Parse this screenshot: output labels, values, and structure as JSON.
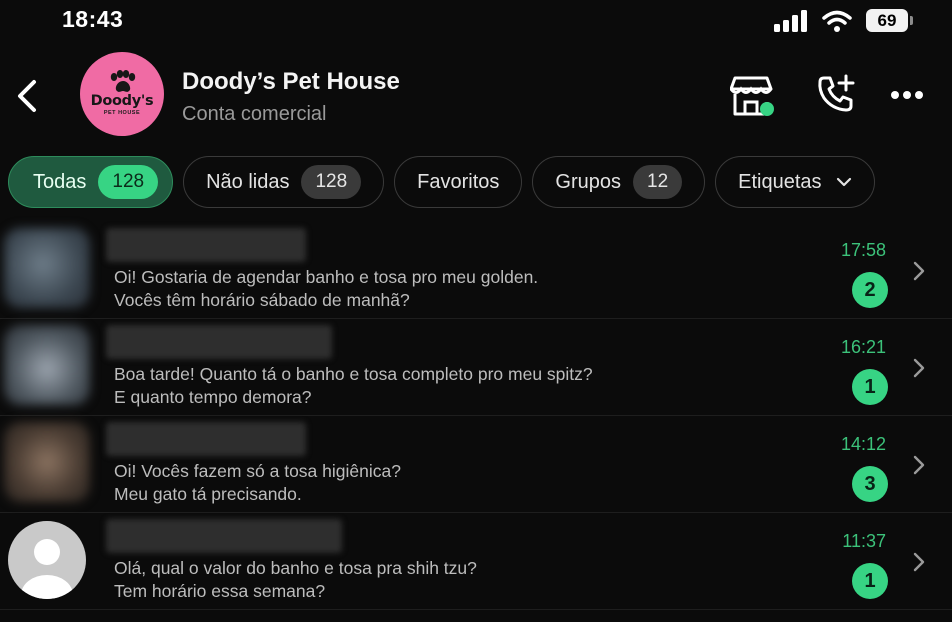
{
  "status_bar": {
    "time": "18:43",
    "battery": "69"
  },
  "header": {
    "avatar_brand": "Doody's",
    "avatar_sub": "PET HOUSE",
    "title": "Doody’s Pet House",
    "subtitle": "Conta comercial"
  },
  "filters": [
    {
      "label": "Todas",
      "count": "128",
      "active": true
    },
    {
      "label": "Não lidas",
      "count": "128"
    },
    {
      "label": "Favoritos"
    },
    {
      "label": "Grupos",
      "count": "12"
    },
    {
      "label": "Etiquetas"
    }
  ],
  "chats": [
    {
      "line1": "Oi! Gostaria de agendar banho e tosa pro meu golden.",
      "line2": "Vocês têm horário sábado de manhã?",
      "time": "17:58",
      "unread": "2"
    },
    {
      "line1": "Boa tarde! Quanto tá o banho e tosa completo pro meu spitz?",
      "line2": "E quanto tempo demora?",
      "time": "16:21",
      "unread": "1"
    },
    {
      "line1": "Oi! Vocês fazem só a tosa higiênica?",
      "line2": "Meu gato tá precisando.",
      "time": "14:12",
      "unread": "3"
    },
    {
      "line1": "Olá, qual o valor do banho e tosa pra shih tzu?",
      "line2": "Tem horário essa semana?",
      "time": "11:37",
      "unread": "1"
    }
  ],
  "colors": {
    "accent": "#37d484",
    "active_chip": "#1f5a3f",
    "time_green": "#3cc27a",
    "brand_pink": "#f06ba4"
  }
}
